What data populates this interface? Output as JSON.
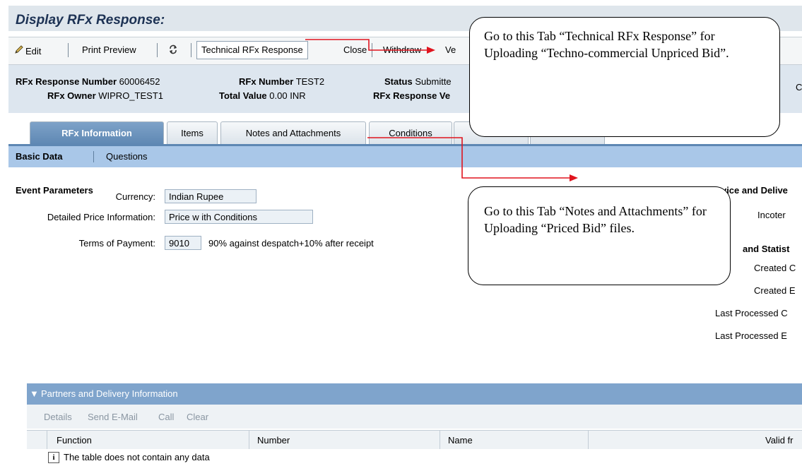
{
  "window": {
    "title": "Display RFx Response:"
  },
  "toolbar": {
    "edit_label": "Edit",
    "print_preview_label": "Print Preview",
    "technical_rfx_response_label": "Technical RFx Response",
    "close_label": "Close",
    "withdraw_label": "Withdraw",
    "truncated_label": "Ve"
  },
  "header": {
    "response_number_label": "RFx Response Number",
    "response_number_value": "60006452",
    "owner_label": "RFx Owner",
    "owner_value": "WIPRO_TEST1",
    "rfx_number_label": "RFx Number",
    "rfx_number_value": "TEST2",
    "total_value_label": "Total Value",
    "total_value_value": "0.00 INR",
    "status_label": "Status",
    "status_value": "Submitte",
    "response_version_label": "RFx Response Ve",
    "right_edge_char": "C"
  },
  "tabs": [
    {
      "label": "RFx Information",
      "active": true
    },
    {
      "label": "Items"
    },
    {
      "label": "Notes and Attachments"
    },
    {
      "label": "Conditions"
    }
  ],
  "subtabs": [
    {
      "label": "Basic Data",
      "active": true
    },
    {
      "label": "Questions"
    }
  ],
  "event_parameters": {
    "section_title": "Event Parameters",
    "currency_label": "Currency:",
    "currency_value": "Indian Rupee",
    "price_info_label": "Detailed Price Information:",
    "price_info_value": "Price w ith Conditions",
    "payment_label": "Terms of Payment:",
    "payment_code": "9010",
    "payment_desc": "90% against despatch+10% after receipt"
  },
  "right_panel": {
    "service_title": "Service and Delive",
    "incoterms_label": "Incoter",
    "statistics_title": "and Statist",
    "created_on": "Created C",
    "created_by": "Created E",
    "last_processed_on": "Last Processed C",
    "last_processed_by": "Last Processed E"
  },
  "partners": {
    "title": "Partners and Delivery Information",
    "tools": [
      "Details",
      "Send E-Mail",
      "Call",
      "Clear"
    ],
    "columns": [
      "Function",
      "Number",
      "Name",
      "Valid fr"
    ],
    "empty_message": "The table does not contain any data"
  },
  "callouts": {
    "top_text": "Go to this Tab “Technical RFx Response” for Uploading “Techno-commercial Unpriced Bid”.",
    "bottom_text": "Go to this Tab “Notes and Attachments” for Uploading “Priced Bid” files."
  },
  "colors": {
    "title": "#1d3254",
    "arrow": "#e0141e",
    "tab_active": "#5e87b3",
    "subtab_bar": "#a9c7e8"
  }
}
